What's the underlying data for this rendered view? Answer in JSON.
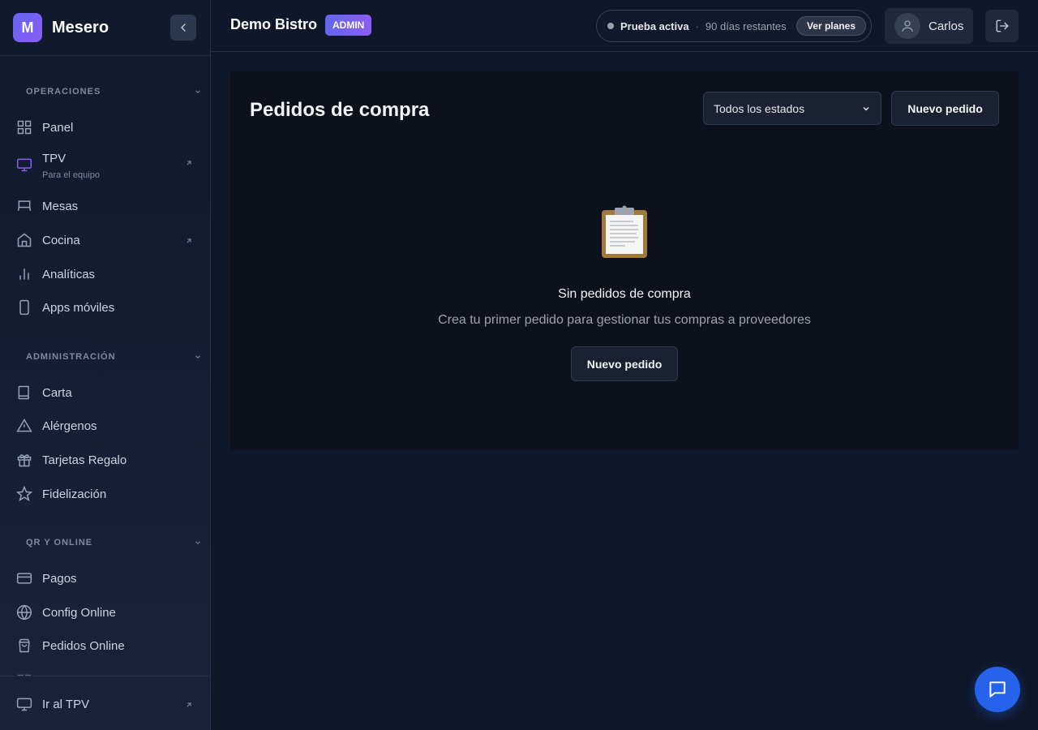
{
  "sidebar": {
    "brand_initial": "M",
    "brand_name": "Mesero",
    "sections": [
      {
        "title": "OPERACIONES",
        "items": [
          {
            "label": "Panel",
            "icon": "grid-icon"
          },
          {
            "label": "TPV",
            "sub": "Para el equipo",
            "icon": "monitor-icon",
            "external": true
          },
          {
            "label": "Mesas",
            "icon": "table-icon"
          },
          {
            "label": "Cocina",
            "icon": "home-icon",
            "external": true
          },
          {
            "label": "Analíticas",
            "icon": "bar-chart-icon"
          },
          {
            "label": "Apps móviles",
            "icon": "phone-icon"
          }
        ]
      },
      {
        "title": "ADMINISTRACIÓN",
        "items": [
          {
            "label": "Carta",
            "icon": "book-icon"
          },
          {
            "label": "Alérgenos",
            "icon": "warning-icon"
          },
          {
            "label": "Tarjetas Regalo",
            "icon": "gift-icon"
          },
          {
            "label": "Fidelización",
            "icon": "star-icon"
          }
        ]
      },
      {
        "title": "QR Y ONLINE",
        "items": [
          {
            "label": "Pagos",
            "icon": "credit-card-icon"
          },
          {
            "label": "Config Online",
            "icon": "globe-icon"
          },
          {
            "label": "Pedidos Online",
            "icon": "shopping-bag-icon"
          }
        ]
      }
    ],
    "footer_label": "Ir al TPV"
  },
  "header": {
    "business_name": "Demo Bistro",
    "role_badge": "ADMIN",
    "trial_status": "Prueba activa",
    "trial_separator": "·",
    "trial_days": "90 días restantes",
    "plans_button": "Ver planes",
    "user_name": "Carlos"
  },
  "main": {
    "title": "Pedidos de compra",
    "filter_selected": "Todos los estados",
    "new_order_button": "Nuevo pedido",
    "empty_title": "Sin pedidos de compra",
    "empty_description": "Crea tu primer pedido para gestionar tus compras a proveedores",
    "empty_button": "Nuevo pedido"
  },
  "colors": {
    "accent": "#6366f1",
    "accent_secondary": "#8b5cf6",
    "chat_button": "#2563eb",
    "background": "#0f172a",
    "card": "#0c111b"
  }
}
